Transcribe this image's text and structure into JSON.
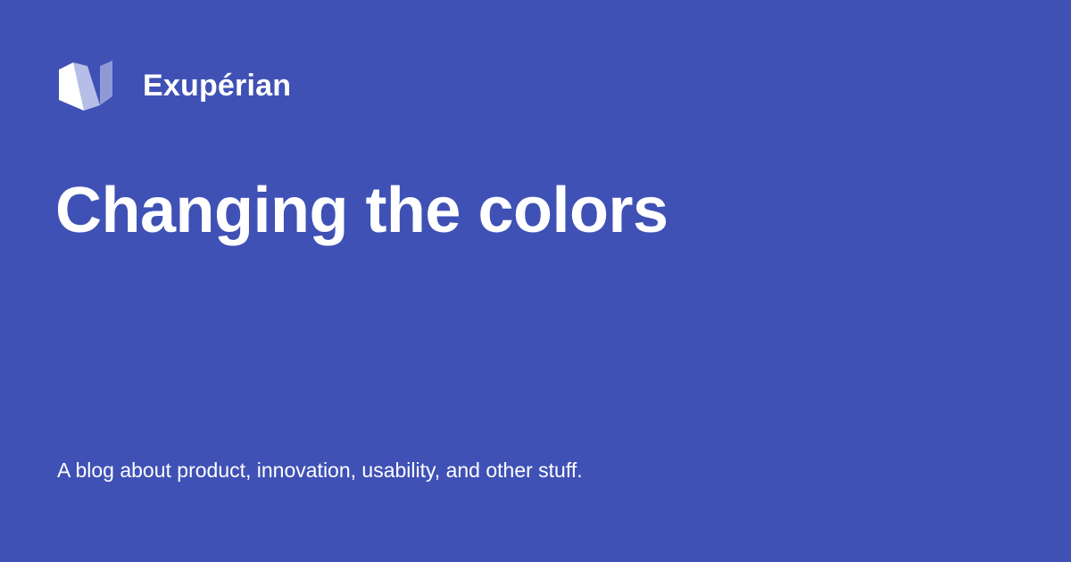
{
  "brand": {
    "name": "Exupérian",
    "logo_icon": "book-logo-icon"
  },
  "post": {
    "title": "Changing the colors"
  },
  "site": {
    "tagline": "A blog about product, innovation, usability, and other stuff."
  },
  "colors": {
    "background": "#3f51b5",
    "text": "#ffffff",
    "logo_light": "#ffffff",
    "logo_mid": "#b6bde6",
    "logo_dark": "#8e99d6"
  }
}
